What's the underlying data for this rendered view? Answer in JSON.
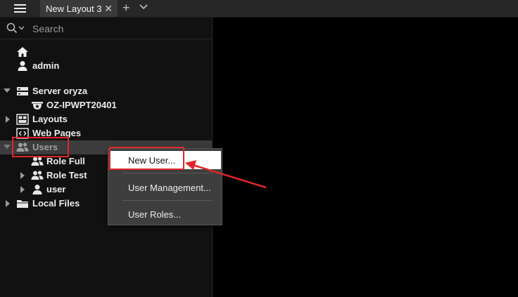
{
  "tabs": {
    "active_label": "New Layout 3",
    "close_glyph": "✕",
    "add_glyph": "+"
  },
  "search": {
    "placeholder": "Search"
  },
  "tree": {
    "user_name": "admin",
    "server": "Server oryza",
    "camera": "OZ-IPWPT20401",
    "layouts": "Layouts",
    "web_pages": "Web Pages",
    "users": "Users",
    "role_full": "Role Full",
    "role_test": "Role Test",
    "user": "user",
    "local_files": "Local Files"
  },
  "context_menu": {
    "new_user": "New User...",
    "user_management": "User Management...",
    "user_roles": "User Roles..."
  },
  "colors": {
    "annotation": "#e0262b",
    "panel_bg": "#111111",
    "menu_bg": "#3e3e3e"
  }
}
